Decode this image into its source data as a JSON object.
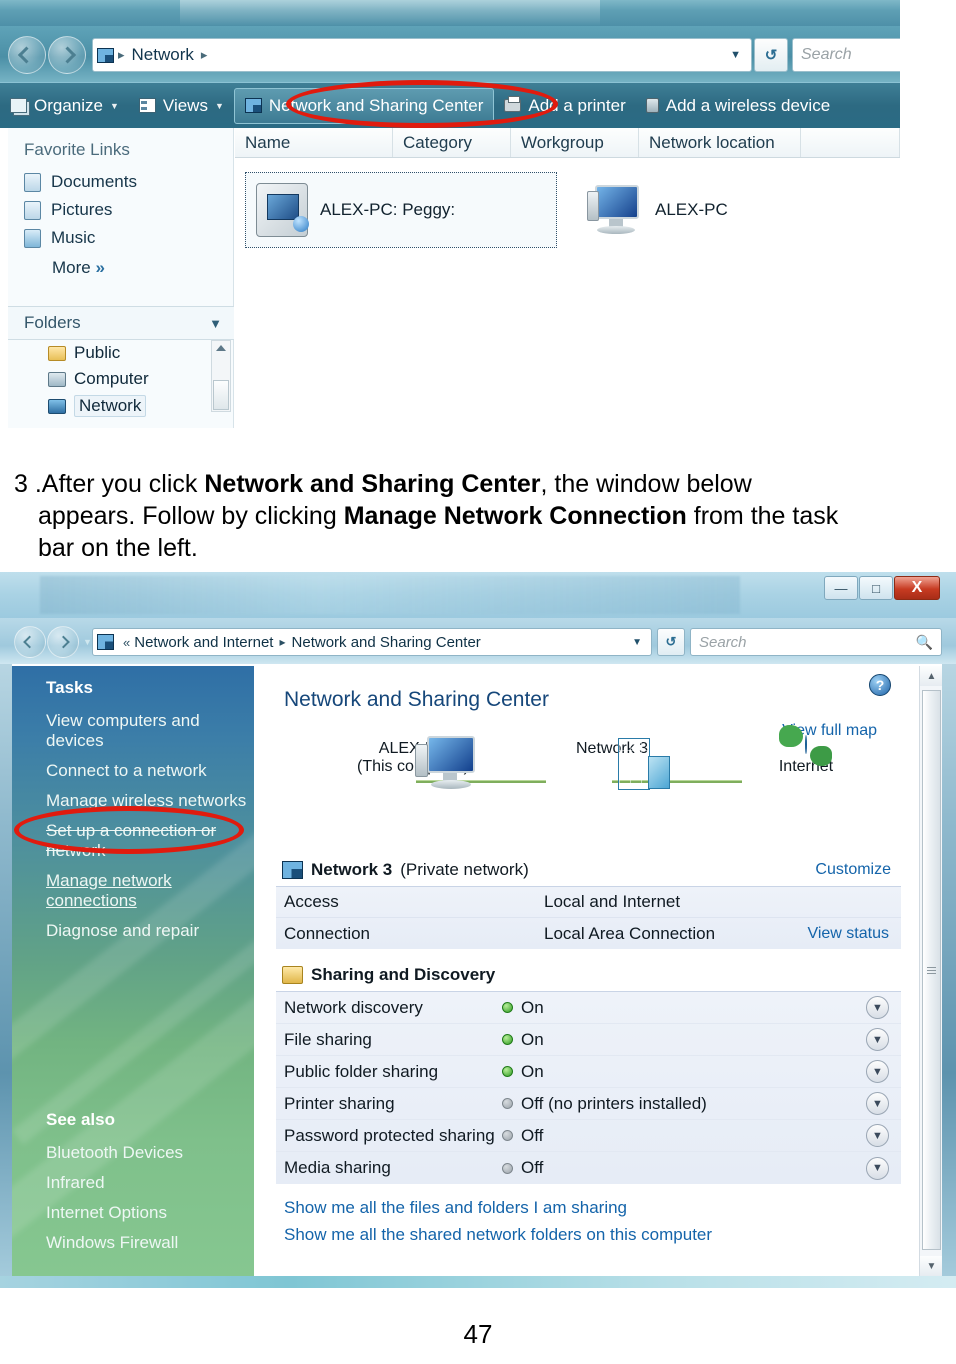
{
  "document": {
    "page_number": "47",
    "instruction": {
      "number": "3 .",
      "line1_pre": "After you click ",
      "line1_bold": "Network and Sharing Center",
      "line1_post": ", the window below",
      "line2_pre": "appears. Follow by clicking ",
      "line2_bold": "Manage Network Connection",
      "line2_post": " from the task",
      "line3": "bar on the left."
    }
  },
  "window_network": {
    "address": {
      "breadcrumb": [
        "Network"
      ],
      "search_placeholder": "Search",
      "refresh_icon": "refresh-icon",
      "dropdown_icon": "chevron-down-icon"
    },
    "toolbar": {
      "organize": "Organize",
      "views": "Views",
      "network_sharing_center": "Network and Sharing Center",
      "add_printer": "Add a printer",
      "add_wireless_device": "Add a wireless device"
    },
    "sidebar": {
      "favorites_title": "Favorite Links",
      "favorites": [
        "Documents",
        "Pictures",
        "Music"
      ],
      "more_label": "More",
      "more_chevron": "»",
      "folders_title": "Folders",
      "folders": [
        "Public",
        "Computer",
        "Network"
      ],
      "selected_folder": "Network"
    },
    "columns": [
      "Name",
      "Category",
      "Workgroup",
      "Network location"
    ],
    "items": [
      {
        "label": "ALEX-PC: Peggy:",
        "icon": "shared-computer-icon",
        "selected": true
      },
      {
        "label": "ALEX-PC",
        "icon": "computer-icon",
        "selected": false
      }
    ],
    "highlight": "Network and Sharing Center"
  },
  "window_nsc": {
    "title_buttons": {
      "minimize": "—",
      "maximize": "□",
      "close": "X"
    },
    "address": {
      "prefix": "«",
      "breadcrumb": [
        "Network and Internet",
        "Network and Sharing Center"
      ],
      "search_placeholder": "Search",
      "search_icon": "search-icon"
    },
    "sidebar": {
      "tasks_title": "Tasks",
      "tasks": [
        "View computers and devices",
        "Connect to a network",
        "Manage wireless networks",
        "Set up a connection or network",
        "Manage network connections",
        "Diagnose and repair"
      ],
      "highlighted_task": "Manage network connections",
      "see_also_title": "See also",
      "see_also": [
        "Bluetooth Devices",
        "Infrared",
        "Internet Options",
        "Windows Firewall"
      ]
    },
    "main": {
      "page_title": "Network and Sharing Center",
      "view_full_map": "View full map",
      "help_icon": "help-icon",
      "map": {
        "nodes": [
          {
            "label": "ALEX-PC",
            "sublabel": "(This computer)",
            "icon": "computer-icon"
          },
          {
            "label": "Network  3",
            "sublabel": "",
            "icon": "network-server-icon"
          },
          {
            "label": "Internet",
            "sublabel": "",
            "icon": "globe-icon"
          }
        ],
        "connector_color": "#7fae5d"
      },
      "network_section": {
        "icon": "network-icon",
        "name": "Network  3",
        "type": "(Private network)",
        "customize_link": "Customize",
        "rows": [
          {
            "key": "Access",
            "value": "Local and Internet",
            "action": ""
          },
          {
            "key": "Connection",
            "value": "Local Area Connection",
            "action": "View status"
          }
        ]
      },
      "sharing_section": {
        "icon": "people-icon",
        "title": "Sharing and Discovery",
        "rows": [
          {
            "key": "Network discovery",
            "state": "on",
            "value": "On"
          },
          {
            "key": "File sharing",
            "state": "on",
            "value": "On"
          },
          {
            "key": "Public folder sharing",
            "state": "on",
            "value": "On"
          },
          {
            "key": "Printer sharing",
            "state": "off",
            "value": "Off (no printers installed)"
          },
          {
            "key": "Password protected sharing",
            "state": "off",
            "value": "Off"
          },
          {
            "key": "Media sharing",
            "state": "off",
            "value": "Off"
          }
        ],
        "expander_icon": "chevron-down-icon"
      },
      "show_links": [
        "Show me all the files and folders I am sharing",
        "Show me all the shared network folders on this computer"
      ]
    },
    "scrollbar": {
      "up": "▲",
      "down": "▼"
    }
  },
  "colors": {
    "highlight_red": "#e01b0e",
    "link_blue": "#1464aa",
    "status_on_green": "#2f9c22",
    "status_off_gray": "#9aa3aa",
    "title_blue": "#16477a"
  }
}
